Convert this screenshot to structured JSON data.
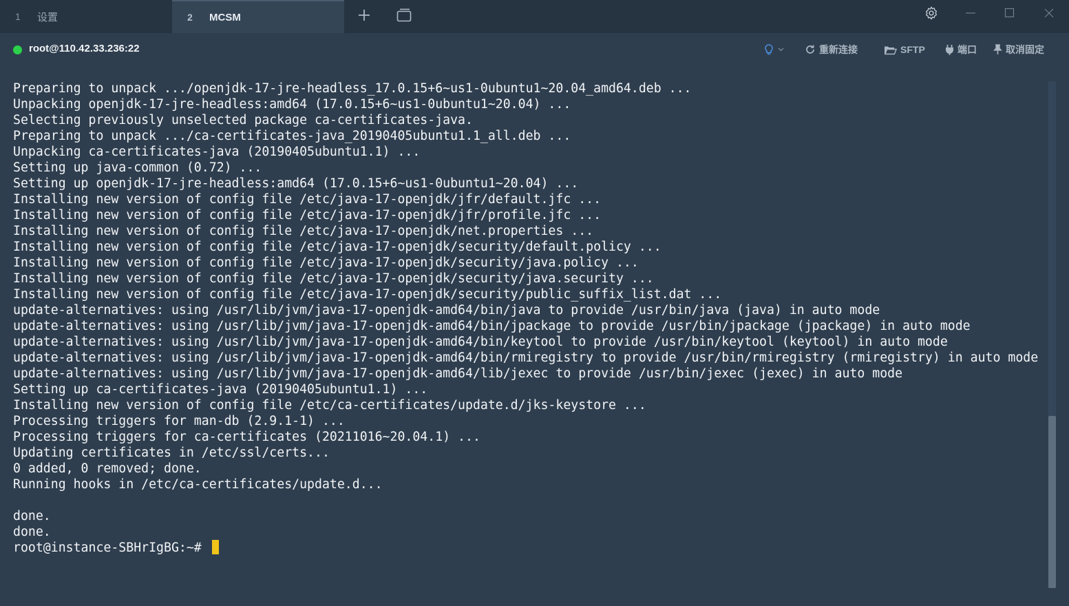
{
  "tabs": [
    {
      "number": "1",
      "label": "设置",
      "active": false
    },
    {
      "number": "2",
      "label": "MCSM",
      "active": true
    }
  ],
  "tabbar": {
    "new_tab_icon": "plus-icon",
    "duplicate_icon": "window-duplicate-icon",
    "settings_icon": "gear-icon",
    "minimize_icon": "minimize-icon",
    "maximize_icon": "maximize-icon",
    "close_icon": "close-icon"
  },
  "connection": {
    "host": "root@110.42.33.236:22",
    "status_color": "#2bd14a"
  },
  "toolbar": {
    "bulb_icon": "bulb-icon",
    "reconnect_label": "重新连接",
    "sftp_label": "SFTP",
    "port_label": "端口",
    "unpin_label": "取消固定"
  },
  "terminal": {
    "lines": [
      "Preparing to unpack .../openjdk-17-jre-headless_17.0.15+6~us1-0ubuntu1~20.04_amd64.deb ...",
      "Unpacking openjdk-17-jre-headless:amd64 (17.0.15+6~us1-0ubuntu1~20.04) ...",
      "Selecting previously unselected package ca-certificates-java.",
      "Preparing to unpack .../ca-certificates-java_20190405ubuntu1.1_all.deb ...",
      "Unpacking ca-certificates-java (20190405ubuntu1.1) ...",
      "Setting up java-common (0.72) ...",
      "Setting up openjdk-17-jre-headless:amd64 (17.0.15+6~us1-0ubuntu1~20.04) ...",
      "Installing new version of config file /etc/java-17-openjdk/jfr/default.jfc ...",
      "Installing new version of config file /etc/java-17-openjdk/jfr/profile.jfc ...",
      "Installing new version of config file /etc/java-17-openjdk/net.properties ...",
      "Installing new version of config file /etc/java-17-openjdk/security/default.policy ...",
      "Installing new version of config file /etc/java-17-openjdk/security/java.policy ...",
      "Installing new version of config file /etc/java-17-openjdk/security/java.security ...",
      "Installing new version of config file /etc/java-17-openjdk/security/public_suffix_list.dat ...",
      "update-alternatives: using /usr/lib/jvm/java-17-openjdk-amd64/bin/java to provide /usr/bin/java (java) in auto mode",
      "update-alternatives: using /usr/lib/jvm/java-17-openjdk-amd64/bin/jpackage to provide /usr/bin/jpackage (jpackage) in auto mode",
      "update-alternatives: using /usr/lib/jvm/java-17-openjdk-amd64/bin/keytool to provide /usr/bin/keytool (keytool) in auto mode",
      "update-alternatives: using /usr/lib/jvm/java-17-openjdk-amd64/bin/rmiregistry to provide /usr/bin/rmiregistry (rmiregistry) in auto mode",
      "update-alternatives: using /usr/lib/jvm/java-17-openjdk-amd64/lib/jexec to provide /usr/bin/jexec (jexec) in auto mode",
      "Setting up ca-certificates-java (20190405ubuntu1.1) ...",
      "Installing new version of config file /etc/ca-certificates/update.d/jks-keystore ...",
      "Processing triggers for man-db (2.9.1-1) ...",
      "Processing triggers for ca-certificates (20211016~20.04.1) ...",
      "Updating certificates in /etc/ssl/certs...",
      "0 added, 0 removed; done.",
      "Running hooks in /etc/ca-certificates/update.d...",
      "",
      "done.",
      "done."
    ],
    "prompt": "root@instance-SBHrIgBG:~# ",
    "cursor_color": "#f0c419",
    "scroll_position": 0.66
  }
}
